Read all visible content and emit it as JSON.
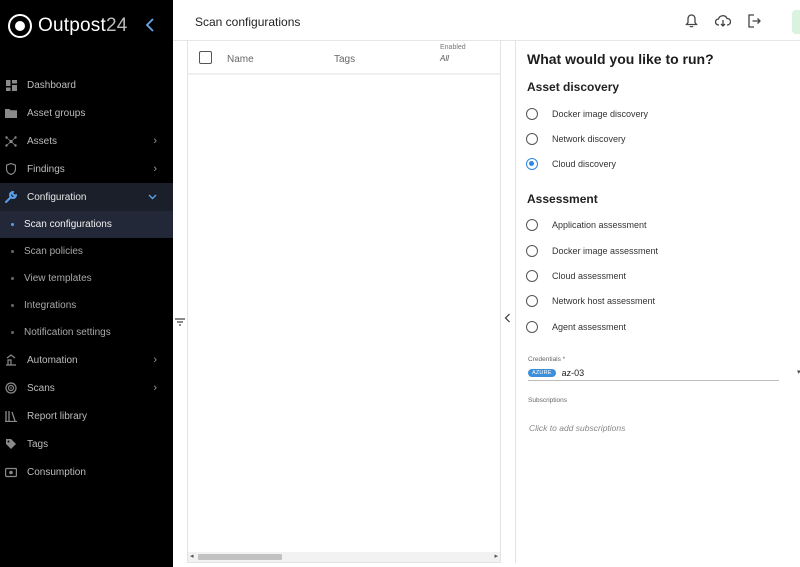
{
  "brand": {
    "name": "Outpost",
    "number": "24"
  },
  "colors": {
    "accent": "#2b87e3",
    "sidebar_bg": "#000000",
    "chip_azure": "#3d8fd9"
  },
  "sidebar": {
    "items": [
      {
        "label": "Dashboard",
        "icon": "dashboard-icon",
        "chevron": false
      },
      {
        "label": "Asset groups",
        "icon": "folder-icon",
        "chevron": false
      },
      {
        "label": "Assets",
        "icon": "network-icon",
        "chevron": true
      },
      {
        "label": "Findings",
        "icon": "shield-icon",
        "chevron": true
      },
      {
        "label": "Configuration",
        "icon": "wrench-icon",
        "chevron": true,
        "expanded": true
      }
    ],
    "subitems": [
      {
        "label": "Scan configurations",
        "selected": true
      },
      {
        "label": "Scan policies"
      },
      {
        "label": "View templates"
      },
      {
        "label": "Integrations"
      },
      {
        "label": "Notification settings"
      }
    ],
    "items_after": [
      {
        "label": "Automation",
        "icon": "automation-icon",
        "chevron": true
      },
      {
        "label": "Scans",
        "icon": "radar-icon",
        "chevron": true
      },
      {
        "label": "Report library",
        "icon": "library-icon",
        "chevron": false
      },
      {
        "label": "Tags",
        "icon": "tag-icon",
        "chevron": false
      },
      {
        "label": "Consumption",
        "icon": "meter-icon",
        "chevron": false
      }
    ]
  },
  "header": {
    "title": "Scan configurations",
    "icons": [
      "bell-icon",
      "cloud-download-icon",
      "logout-icon"
    ]
  },
  "table": {
    "columns": {
      "name": "Name",
      "tags": "Tags",
      "enabled": "Enabled",
      "enabled_filter": "All"
    }
  },
  "panel": {
    "title": "What would you like to run?",
    "sections": [
      {
        "title": "Asset discovery",
        "options": [
          {
            "label": "Docker image discovery",
            "checked": false
          },
          {
            "label": "Network discovery",
            "checked": false
          },
          {
            "label": "Cloud discovery",
            "checked": true
          }
        ]
      },
      {
        "title": "Assessment",
        "options": [
          {
            "label": "Application assessment",
            "checked": false
          },
          {
            "label": "Docker image assessment",
            "checked": false
          },
          {
            "label": "Cloud assessment",
            "checked": false
          },
          {
            "label": "Network host assessment",
            "checked": false
          },
          {
            "label": "Agent assessment",
            "checked": false
          }
        ]
      }
    ],
    "credentials": {
      "label": "Credentials *",
      "chip": "AZURE",
      "value": "az-03"
    },
    "subscriptions": {
      "label": "Subscriptions",
      "placeholder": "Click to add subscriptions"
    }
  }
}
